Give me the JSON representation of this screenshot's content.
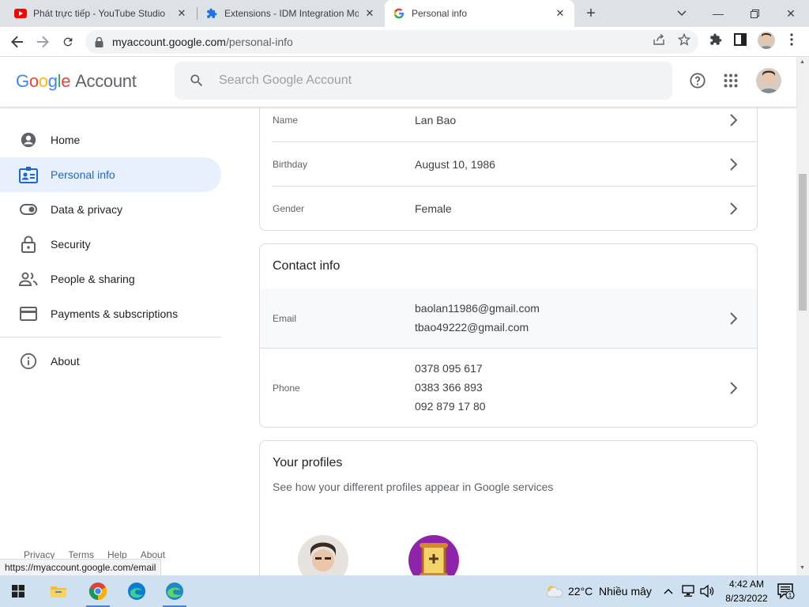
{
  "tabs": [
    {
      "title": "Phát trực tiếp - YouTube Studio",
      "icon": "youtube-icon"
    },
    {
      "title": "Extensions - IDM Integration Mo",
      "icon": "puzzle-icon"
    },
    {
      "title": "Personal info",
      "icon": "google-g-icon"
    }
  ],
  "address": {
    "host": "myaccount.google.com",
    "path": "/personal-info"
  },
  "header": {
    "logo": {
      "google": "Google",
      "account": "Account"
    },
    "search_placeholder": "Search Google Account"
  },
  "sidebar": {
    "items": [
      {
        "label": "Home",
        "icon": "account-circle-icon"
      },
      {
        "label": "Personal info",
        "icon": "badge-icon",
        "active": true
      },
      {
        "label": "Data & privacy",
        "icon": "toggle-icon"
      },
      {
        "label": "Security",
        "icon": "lock-icon"
      },
      {
        "label": "People & sharing",
        "icon": "people-icon"
      },
      {
        "label": "Payments & subscriptions",
        "icon": "credit-card-icon"
      }
    ],
    "about": "About",
    "footer": [
      "Privacy",
      "Terms",
      "Help",
      "About"
    ]
  },
  "basic_info": {
    "rows": [
      {
        "label": "Name",
        "value": "Lan Bao"
      },
      {
        "label": "Birthday",
        "value": "August 10, 1986"
      },
      {
        "label": "Gender",
        "value": "Female"
      }
    ]
  },
  "contact_info": {
    "title": "Contact info",
    "email_label": "Email",
    "emails": [
      "baolan11986@gmail.com",
      "tbao49222@gmail.com"
    ],
    "phone_label": "Phone",
    "phones": [
      "0378 095 617",
      "0383 366 893",
      "092 879 17 80"
    ]
  },
  "profiles": {
    "title": "Your profiles",
    "subtitle": "See how your different profiles appear in Google services"
  },
  "status_url": "https://myaccount.google.com/email",
  "taskbar": {
    "weather_temp": "22°C",
    "weather_text": "Nhiều mây",
    "time": "4:42 AM",
    "date": "8/23/2022",
    "notifications": "1"
  },
  "colors": {
    "accent": "#1a73e8",
    "active_bg": "#e8f0fe",
    "taskbar": "#cfe1f0"
  }
}
